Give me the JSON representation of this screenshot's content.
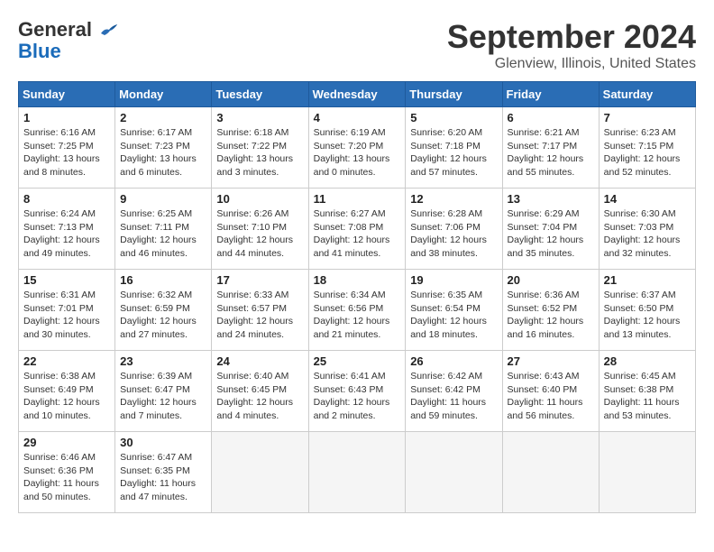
{
  "header": {
    "logo": {
      "line1": "General",
      "line2": "Blue"
    },
    "title": "September 2024",
    "subtitle": "Glenview, Illinois, United States"
  },
  "calendar": {
    "days_of_week": [
      "Sunday",
      "Monday",
      "Tuesday",
      "Wednesday",
      "Thursday",
      "Friday",
      "Saturday"
    ],
    "weeks": [
      [
        {
          "day": "1",
          "sunrise": "Sunrise: 6:16 AM",
          "sunset": "Sunset: 7:25 PM",
          "daylight": "Daylight: 13 hours and 8 minutes."
        },
        {
          "day": "2",
          "sunrise": "Sunrise: 6:17 AM",
          "sunset": "Sunset: 7:23 PM",
          "daylight": "Daylight: 13 hours and 6 minutes."
        },
        {
          "day": "3",
          "sunrise": "Sunrise: 6:18 AM",
          "sunset": "Sunset: 7:22 PM",
          "daylight": "Daylight: 13 hours and 3 minutes."
        },
        {
          "day": "4",
          "sunrise": "Sunrise: 6:19 AM",
          "sunset": "Sunset: 7:20 PM",
          "daylight": "Daylight: 13 hours and 0 minutes."
        },
        {
          "day": "5",
          "sunrise": "Sunrise: 6:20 AM",
          "sunset": "Sunset: 7:18 PM",
          "daylight": "Daylight: 12 hours and 57 minutes."
        },
        {
          "day": "6",
          "sunrise": "Sunrise: 6:21 AM",
          "sunset": "Sunset: 7:17 PM",
          "daylight": "Daylight: 12 hours and 55 minutes."
        },
        {
          "day": "7",
          "sunrise": "Sunrise: 6:23 AM",
          "sunset": "Sunset: 7:15 PM",
          "daylight": "Daylight: 12 hours and 52 minutes."
        }
      ],
      [
        {
          "day": "8",
          "sunrise": "Sunrise: 6:24 AM",
          "sunset": "Sunset: 7:13 PM",
          "daylight": "Daylight: 12 hours and 49 minutes."
        },
        {
          "day": "9",
          "sunrise": "Sunrise: 6:25 AM",
          "sunset": "Sunset: 7:11 PM",
          "daylight": "Daylight: 12 hours and 46 minutes."
        },
        {
          "day": "10",
          "sunrise": "Sunrise: 6:26 AM",
          "sunset": "Sunset: 7:10 PM",
          "daylight": "Daylight: 12 hours and 44 minutes."
        },
        {
          "day": "11",
          "sunrise": "Sunrise: 6:27 AM",
          "sunset": "Sunset: 7:08 PM",
          "daylight": "Daylight: 12 hours and 41 minutes."
        },
        {
          "day": "12",
          "sunrise": "Sunrise: 6:28 AM",
          "sunset": "Sunset: 7:06 PM",
          "daylight": "Daylight: 12 hours and 38 minutes."
        },
        {
          "day": "13",
          "sunrise": "Sunrise: 6:29 AM",
          "sunset": "Sunset: 7:04 PM",
          "daylight": "Daylight: 12 hours and 35 minutes."
        },
        {
          "day": "14",
          "sunrise": "Sunrise: 6:30 AM",
          "sunset": "Sunset: 7:03 PM",
          "daylight": "Daylight: 12 hours and 32 minutes."
        }
      ],
      [
        {
          "day": "15",
          "sunrise": "Sunrise: 6:31 AM",
          "sunset": "Sunset: 7:01 PM",
          "daylight": "Daylight: 12 hours and 30 minutes."
        },
        {
          "day": "16",
          "sunrise": "Sunrise: 6:32 AM",
          "sunset": "Sunset: 6:59 PM",
          "daylight": "Daylight: 12 hours and 27 minutes."
        },
        {
          "day": "17",
          "sunrise": "Sunrise: 6:33 AM",
          "sunset": "Sunset: 6:57 PM",
          "daylight": "Daylight: 12 hours and 24 minutes."
        },
        {
          "day": "18",
          "sunrise": "Sunrise: 6:34 AM",
          "sunset": "Sunset: 6:56 PM",
          "daylight": "Daylight: 12 hours and 21 minutes."
        },
        {
          "day": "19",
          "sunrise": "Sunrise: 6:35 AM",
          "sunset": "Sunset: 6:54 PM",
          "daylight": "Daylight: 12 hours and 18 minutes."
        },
        {
          "day": "20",
          "sunrise": "Sunrise: 6:36 AM",
          "sunset": "Sunset: 6:52 PM",
          "daylight": "Daylight: 12 hours and 16 minutes."
        },
        {
          "day": "21",
          "sunrise": "Sunrise: 6:37 AM",
          "sunset": "Sunset: 6:50 PM",
          "daylight": "Daylight: 12 hours and 13 minutes."
        }
      ],
      [
        {
          "day": "22",
          "sunrise": "Sunrise: 6:38 AM",
          "sunset": "Sunset: 6:49 PM",
          "daylight": "Daylight: 12 hours and 10 minutes."
        },
        {
          "day": "23",
          "sunrise": "Sunrise: 6:39 AM",
          "sunset": "Sunset: 6:47 PM",
          "daylight": "Daylight: 12 hours and 7 minutes."
        },
        {
          "day": "24",
          "sunrise": "Sunrise: 6:40 AM",
          "sunset": "Sunset: 6:45 PM",
          "daylight": "Daylight: 12 hours and 4 minutes."
        },
        {
          "day": "25",
          "sunrise": "Sunrise: 6:41 AM",
          "sunset": "Sunset: 6:43 PM",
          "daylight": "Daylight: 12 hours and 2 minutes."
        },
        {
          "day": "26",
          "sunrise": "Sunrise: 6:42 AM",
          "sunset": "Sunset: 6:42 PM",
          "daylight": "Daylight: 11 hours and 59 minutes."
        },
        {
          "day": "27",
          "sunrise": "Sunrise: 6:43 AM",
          "sunset": "Sunset: 6:40 PM",
          "daylight": "Daylight: 11 hours and 56 minutes."
        },
        {
          "day": "28",
          "sunrise": "Sunrise: 6:45 AM",
          "sunset": "Sunset: 6:38 PM",
          "daylight": "Daylight: 11 hours and 53 minutes."
        }
      ],
      [
        {
          "day": "29",
          "sunrise": "Sunrise: 6:46 AM",
          "sunset": "Sunset: 6:36 PM",
          "daylight": "Daylight: 11 hours and 50 minutes."
        },
        {
          "day": "30",
          "sunrise": "Sunrise: 6:47 AM",
          "sunset": "Sunset: 6:35 PM",
          "daylight": "Daylight: 11 hours and 47 minutes."
        },
        {
          "day": "",
          "sunrise": "",
          "sunset": "",
          "daylight": ""
        },
        {
          "day": "",
          "sunrise": "",
          "sunset": "",
          "daylight": ""
        },
        {
          "day": "",
          "sunrise": "",
          "sunset": "",
          "daylight": ""
        },
        {
          "day": "",
          "sunrise": "",
          "sunset": "",
          "daylight": ""
        },
        {
          "day": "",
          "sunrise": "",
          "sunset": "",
          "daylight": ""
        }
      ]
    ]
  }
}
